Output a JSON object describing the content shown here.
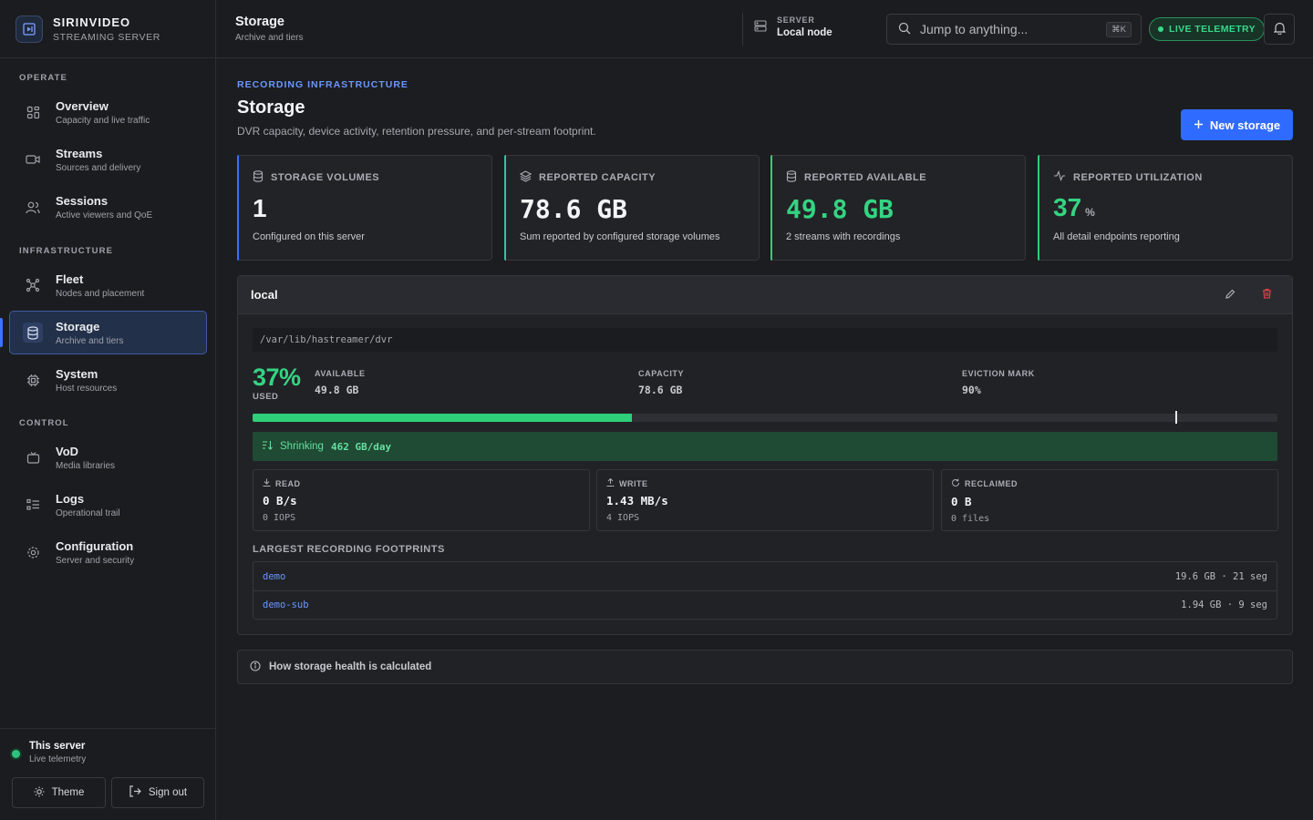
{
  "brand": {
    "title": "SIRINVIDEO",
    "subtitle": "STREAMING SERVER"
  },
  "nav": {
    "sections": {
      "operate": "OPERATE",
      "infrastructure": "INFRASTRUCTURE",
      "control": "CONTROL"
    },
    "items": [
      {
        "label": "Overview",
        "sub": "Capacity and live traffic",
        "icon": "grid-icon"
      },
      {
        "label": "Streams",
        "sub": "Sources and delivery",
        "icon": "video-icon"
      },
      {
        "label": "Sessions",
        "sub": "Active viewers and QoE",
        "icon": "users-icon"
      },
      {
        "label": "Fleet",
        "sub": "Nodes and placement",
        "icon": "network-icon"
      },
      {
        "label": "Storage",
        "sub": "Archive and tiers",
        "icon": "database-icon",
        "active": true
      },
      {
        "label": "System",
        "sub": "Host resources",
        "icon": "cpu-icon"
      },
      {
        "label": "VoD",
        "sub": "Media libraries",
        "icon": "tv-icon"
      },
      {
        "label": "Logs",
        "sub": "Operational trail",
        "icon": "list-icon"
      },
      {
        "label": "Configuration",
        "sub": "Server and security",
        "icon": "gear-icon"
      }
    ]
  },
  "footer": {
    "server_title": "This server",
    "server_sub": "Live telemetry",
    "theme_label": "Theme",
    "signout_label": "Sign out"
  },
  "topbar": {
    "title": "Storage",
    "subtitle": "Archive and tiers",
    "server_label": "SERVER",
    "server_value": "Local node",
    "search_placeholder": "Jump to anything...",
    "search_shortcut": "⌘K",
    "live_label": "LIVE TELEMETRY"
  },
  "page": {
    "eyebrow": "RECORDING INFRASTRUCTURE",
    "title": "Storage",
    "description": "DVR capacity, device activity, retention pressure, and per-stream footprint.",
    "new_button": "New storage"
  },
  "stats": [
    {
      "label": "STORAGE VOLUMES",
      "value": "1",
      "unit": "",
      "note": "Configured on this server",
      "accent": "#3d6cff"
    },
    {
      "label": "REPORTED CAPACITY",
      "value": "78.6 GB",
      "unit": "",
      "note": "Sum reported by configured storage volumes",
      "accent": "#2ec4a4"
    },
    {
      "label": "REPORTED AVAILABLE",
      "value": "49.8 GB",
      "unit": "",
      "note": "2 streams with recordings",
      "accent": "#2ecf78"
    },
    {
      "label": "REPORTED UTILIZATION",
      "value": "37",
      "unit": "%",
      "note": "All detail endpoints reporting",
      "accent": "#2ecf78"
    }
  ],
  "volume": {
    "name": "local",
    "path": "/var/lib/hastreamer/dvr",
    "used_percent": "37%",
    "used_label": "USED",
    "used_fraction": 0.37,
    "eviction_fraction": 0.9,
    "available_label": "AVAILABLE",
    "available_value": "49.8 GB",
    "capacity_label": "CAPACITY",
    "capacity_value": "78.6 GB",
    "eviction_label": "EVICTION MARK",
    "eviction_value": "90%",
    "trend_label": "Shrinking",
    "trend_value": "462 GB/day",
    "io": [
      {
        "label": "READ",
        "value": "0 B/s",
        "sub": "0 IOPS",
        "icon": "download-icon"
      },
      {
        "label": "WRITE",
        "value": "1.43 MB/s",
        "sub": "4 IOPS",
        "icon": "upload-icon"
      },
      {
        "label": "RECLAIMED",
        "value": "0 B",
        "sub": "0 files",
        "icon": "refresh-icon"
      }
    ],
    "footprints_title": "LARGEST RECORDING FOOTPRINTS",
    "footprints": [
      {
        "name": "demo",
        "meta": "19.6 GB · 21 seg"
      },
      {
        "name": "demo-sub",
        "meta": "1.94 GB · 9 seg"
      }
    ]
  },
  "howto": {
    "label": "How storage health is calculated"
  },
  "colors": {
    "accent": "#2f6bff",
    "success": "#34d482",
    "danger": "#e5484d"
  }
}
